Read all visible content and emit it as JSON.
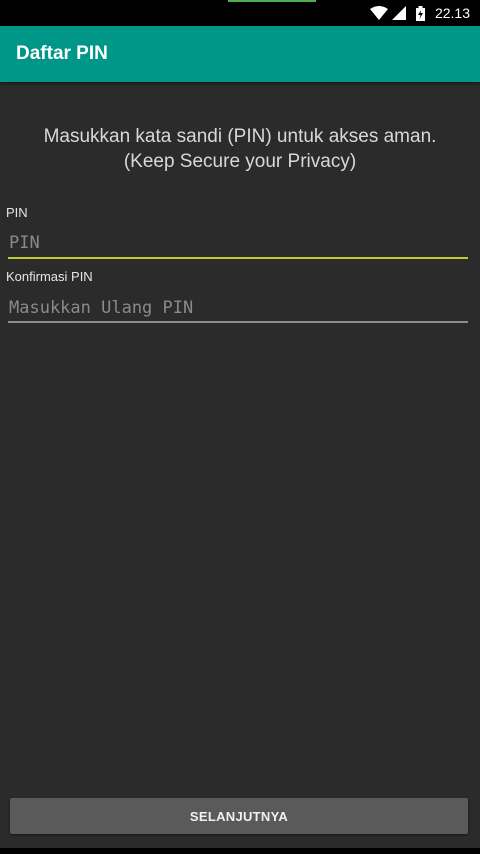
{
  "status_bar": {
    "time": "22.13",
    "wifi_icon": "wifi-icon",
    "signal_icon": "cell-signal-icon",
    "battery_icon": "battery-charging-icon"
  },
  "app_bar": {
    "title": "Daftar PIN",
    "color": "#009688"
  },
  "instructions": {
    "line1": "Masukkan kata sandi (PIN) untuk akses aman.",
    "line2": "(Keep Secure your Privacy)"
  },
  "form": {
    "pin": {
      "label": "PIN",
      "placeholder": "PIN",
      "value": ""
    },
    "confirm_pin": {
      "label": "Konfirmasi PIN",
      "placeholder": "Masukkan Ulang PIN",
      "value": ""
    }
  },
  "actions": {
    "next_label": "SELANJUTNYA"
  },
  "colors": {
    "background": "#2b2b2b",
    "focus_accent": "#c0ca33",
    "button": "#5a5a5a"
  }
}
